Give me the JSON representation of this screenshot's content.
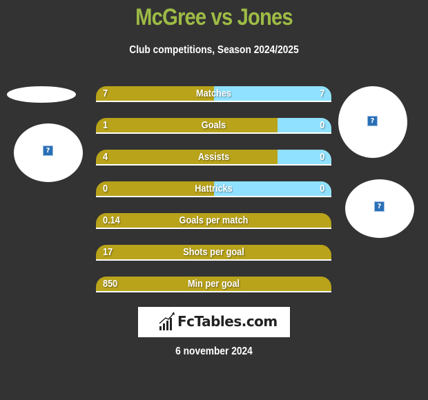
{
  "header": {
    "title": "McGree vs Jones",
    "subtitle": "Club competitions, Season 2024/2025"
  },
  "colors": {
    "background": "#333333",
    "title": "#9dbb45",
    "left_bar": "#b8a31a",
    "right_bar": "#90e1ff"
  },
  "players": {
    "left": {
      "name": "McGree",
      "image_icon": "broken-image-icon"
    },
    "right": {
      "name": "Jones",
      "image_icon": "broken-image-icon"
    },
    "right_club": {
      "image_icon": "broken-image-icon"
    }
  },
  "stats": [
    {
      "label": "Matches",
      "left": "7",
      "right": "7",
      "left_share": 0.5
    },
    {
      "label": "Goals",
      "left": "1",
      "right": "0",
      "left_share": 0.77
    },
    {
      "label": "Assists",
      "left": "4",
      "right": "0",
      "left_share": 0.77
    },
    {
      "label": "Hattricks",
      "left": "0",
      "right": "0",
      "left_share": 0.5
    },
    {
      "label": "Goals per match",
      "left": "0.14",
      "right": "",
      "left_share": 1.0
    },
    {
      "label": "Shots per goal",
      "left": "17",
      "right": "",
      "left_share": 1.0
    },
    {
      "label": "Min per goal",
      "left": "850",
      "right": "",
      "left_share": 1.0
    }
  ],
  "footer": {
    "logo_text": "FcTables.com",
    "date": "6 november 2024"
  }
}
